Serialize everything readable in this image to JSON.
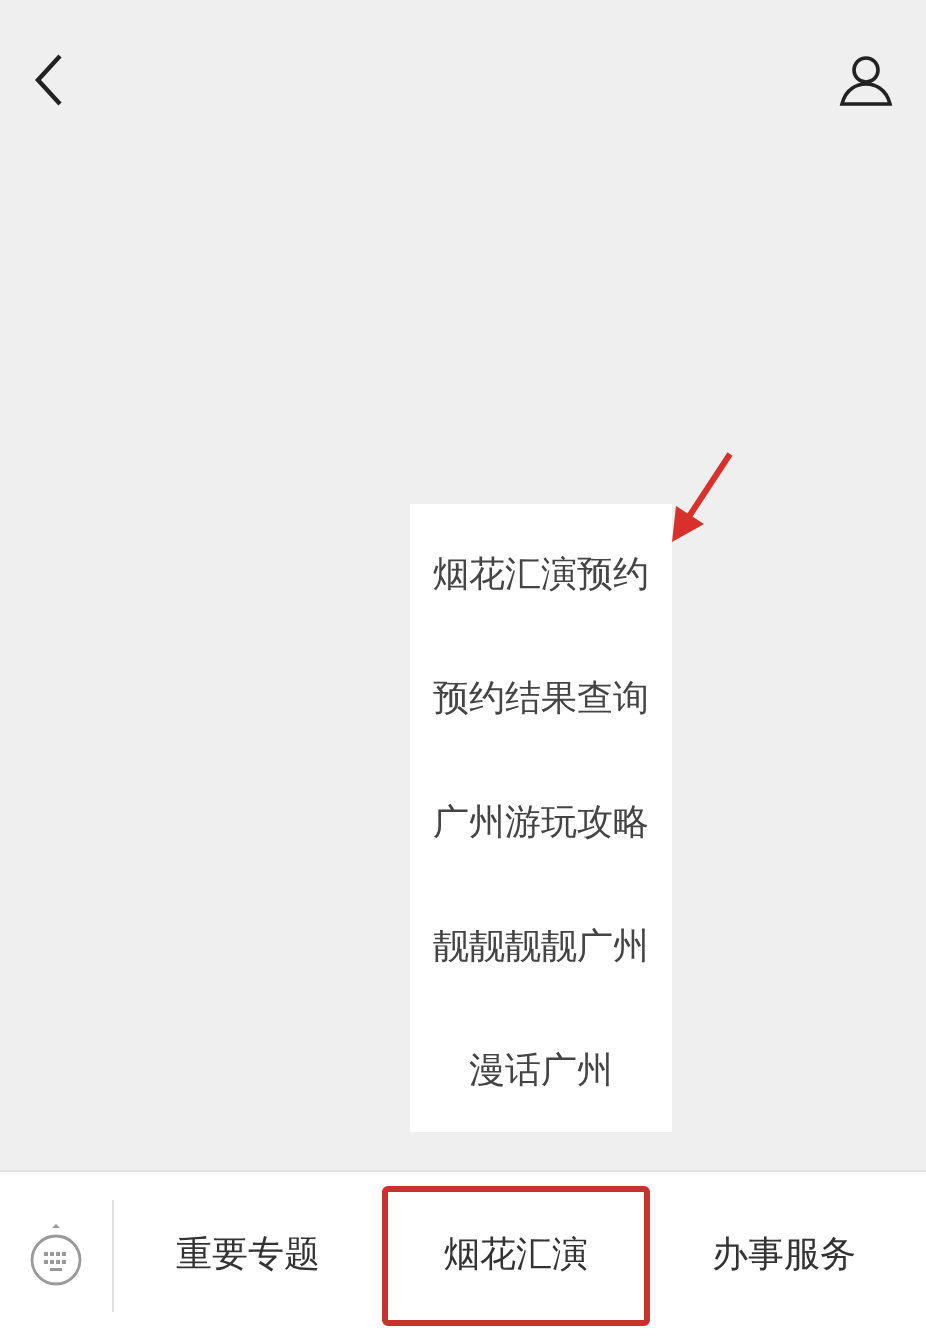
{
  "menu": {
    "items": [
      {
        "label": "烟花汇演预约"
      },
      {
        "label": "预约结果查询"
      },
      {
        "label": "广州游玩攻略"
      },
      {
        "label": "靓靓靓靓广州"
      },
      {
        "label": "漫话广州"
      }
    ]
  },
  "tabs": [
    {
      "label": "重要专题",
      "highlighted": false
    },
    {
      "label": "烟花汇演",
      "highlighted": true
    },
    {
      "label": "办事服务",
      "highlighted": false
    }
  ]
}
